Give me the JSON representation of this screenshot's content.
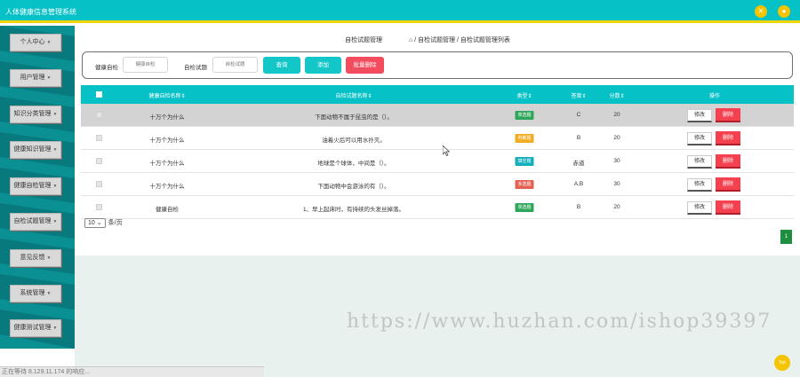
{
  "app": {
    "title": "人体健康信息管理系统"
  },
  "header": {
    "icons": [
      "close-icon",
      "user-icon"
    ]
  },
  "sidebar": {
    "items": [
      {
        "label": "个人中心"
      },
      {
        "label": "用户管理"
      },
      {
        "label": "知识分类管理"
      },
      {
        "label": "健康知识管理"
      },
      {
        "label": "健康自检管理"
      },
      {
        "label": "自检试题管理"
      },
      {
        "label": "意见反馈"
      },
      {
        "label": "系统管理"
      },
      {
        "label": "健康测试管理"
      }
    ]
  },
  "breadcrumb": {
    "current": "自检试题管理",
    "path": "/ 自检试题管理 / 自检试题管理列表"
  },
  "search": {
    "field1_label": "健康自检",
    "field1_placeholder": "健康自检",
    "field2_label": "自检试题",
    "field2_placeholder": "自检试题",
    "query_btn": "查询",
    "add_btn": "添加",
    "batch_delete_btn": "批量删除"
  },
  "table": {
    "headers": {
      "name": "健康自检名称",
      "question": "自检试题名称",
      "type": "类型",
      "answer": "答案",
      "score": "分数",
      "ops": "操作"
    },
    "rows": [
      {
        "name": "十万个为什么",
        "question": "下面动物不属于昆虫的是（）。",
        "type": "单选题",
        "answer": "C",
        "score": "20"
      },
      {
        "name": "十万个为什么",
        "question": "油着火后可以用水扑灭。",
        "type": "判断题",
        "answer": "B",
        "score": "20"
      },
      {
        "name": "十万个为什么",
        "question": "地球是个球体，中间是（）。",
        "type": "填空题",
        "answer": "赤道",
        "score": "30"
      },
      {
        "name": "十万个为什么",
        "question": "下面动物中会游泳的有（）。",
        "type": "多选题",
        "answer": "A,B",
        "score": "30"
      },
      {
        "name": "健康自检",
        "question": "1、早上起床时，有持续的头发丝掉落。",
        "type": "单选题",
        "answer": "B",
        "score": "20"
      }
    ],
    "edit_label": "修改",
    "delete_label": "删除"
  },
  "pagination": {
    "page_size": "10",
    "per_page_suffix": "条/页",
    "current_page": "1"
  },
  "watermark": "https://www.huzhan.com/ishop39397",
  "statusbar": "正在等待 8.129.11.174 的响应...",
  "fab": {
    "label": "Top"
  },
  "colors": {
    "primary": "#06c2c6",
    "accent": "#f2d500",
    "danger": "#f4404f",
    "sidebar": "#0a8f93"
  }
}
